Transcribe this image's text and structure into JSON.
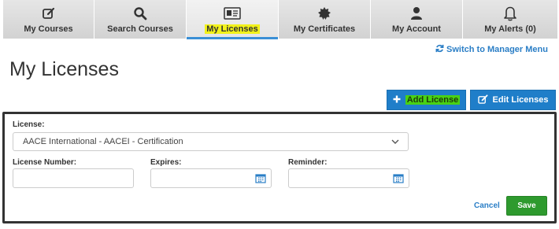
{
  "nav": {
    "tabs": [
      {
        "label": "My Courses",
        "icon": "edit-icon",
        "active": false
      },
      {
        "label": "Search Courses",
        "icon": "search-icon",
        "active": false
      },
      {
        "label": "My Licenses",
        "icon": "license-card-icon",
        "active": true
      },
      {
        "label": "My Certificates",
        "icon": "certificate-seal-icon",
        "active": false
      },
      {
        "label": "My Account",
        "icon": "user-icon",
        "active": false
      },
      {
        "label": "My Alerts (0)",
        "icon": "bell-icon",
        "active": false
      }
    ]
  },
  "header": {
    "switch_link": "Switch to Manager Menu",
    "title": "My Licenses"
  },
  "actions": {
    "add_license": "Add License",
    "edit_licenses": "Edit Licenses"
  },
  "form": {
    "license_label": "License:",
    "license_value": "AACE International - AACEI - Certification",
    "number_label": "License Number:",
    "number_value": "",
    "expires_label": "Expires:",
    "expires_value": "",
    "reminder_label": "Reminder:",
    "reminder_value": "",
    "cancel_label": "Cancel",
    "save_label": "Save"
  },
  "colors": {
    "accent": "#1f7ec9",
    "link": "#2a7ec6",
    "save": "#2e9a2e",
    "tab_highlight": "#f2f21a",
    "button_highlight": "#49d114"
  }
}
